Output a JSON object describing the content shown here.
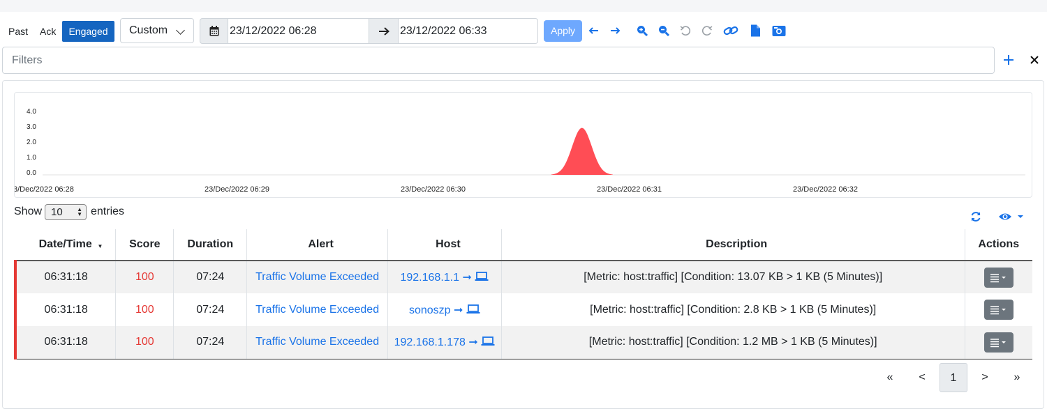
{
  "toolbar": {
    "past_label": "Past",
    "ack_label": "Ack",
    "engaged_label": "Engaged",
    "range_select": "Custom",
    "start_datetime": "23/12/2022 06:28",
    "end_datetime": "23/12/2022 06:33",
    "apply_label": "Apply",
    "icons": [
      "calendar-icon",
      "arrow-right-icon",
      "arrow-left-icon",
      "arrow-right-icon",
      "zoom-in-icon",
      "zoom-out-icon",
      "undo-icon",
      "redo-icon",
      "link-icon",
      "file-icon",
      "screenshot-icon"
    ]
  },
  "filters": {
    "placeholder": "Filters"
  },
  "chart_data": {
    "type": "area",
    "color": "#ff4d55",
    "y_ticks": [
      "4.0",
      "3.0",
      "2.0",
      "1.0",
      "0.0"
    ],
    "ylim": [
      0,
      4
    ],
    "x_ticks": [
      "3/Dec/2022 06:28",
      "23/Dec/2022 06:29",
      "23/Dec/2022 06:30",
      "23/Dec/2022 06:31",
      "23/Dec/2022 06:32"
    ],
    "peak": {
      "x": "23/Dec/2022 06:30:45",
      "y": 3
    }
  },
  "entries": {
    "show_label": "Show",
    "count": "10",
    "suffix_label": "entries"
  },
  "table": {
    "headers": [
      "Date/Time",
      "Score",
      "Duration",
      "Alert",
      "Host",
      "Description",
      "Actions"
    ],
    "rows": [
      {
        "time": "06:31:18",
        "score": "100",
        "duration": "07:24",
        "alert": "Traffic Volume Exceeded",
        "host": "192.168.1.1",
        "description": "[Metric: host:traffic] [Condition: 13.07 KB > 1 KB (5 Minutes)]"
      },
      {
        "time": "06:31:18",
        "score": "100",
        "duration": "07:24",
        "alert": "Traffic Volume Exceeded",
        "host": "sonoszp",
        "description": "[Metric: host:traffic] [Condition: 2.8 KB > 1 KB (5 Minutes)]"
      },
      {
        "time": "06:31:18",
        "score": "100",
        "duration": "07:24",
        "alert": "Traffic Volume Exceeded",
        "host": "192.168.1.178",
        "description": "[Metric: host:traffic] [Condition: 1.2 MB > 1 KB (5 Minutes)]"
      }
    ]
  },
  "pagination": {
    "first": "«",
    "prev": "<",
    "current": "1",
    "next": ">",
    "last": "»"
  },
  "colors": {
    "accent": "#1565c0",
    "alert_red": "#e53935",
    "link": "#1a73e8",
    "chart": "#ff4d55"
  }
}
